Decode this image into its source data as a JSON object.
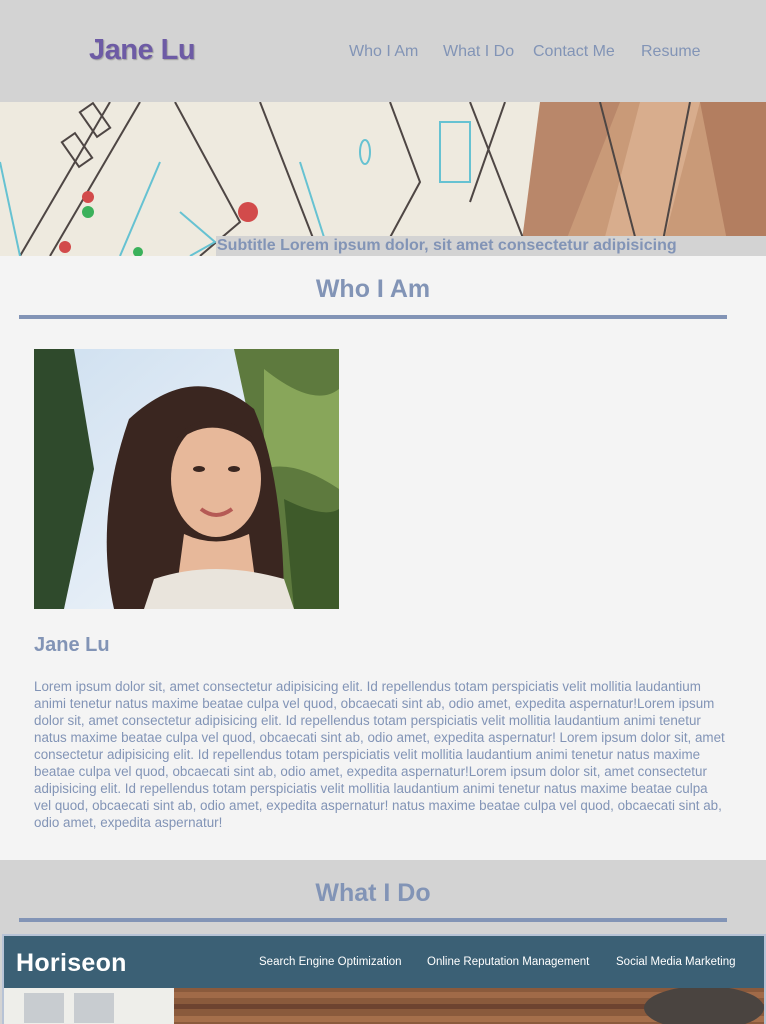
{
  "header": {
    "brand": "Jane Lu",
    "nav": [
      "Who I Am",
      "What I Do",
      "Contact Me",
      "Resume"
    ]
  },
  "hero": {
    "subtitle": "Subtitle Lorem ipsum dolor, sit amet consectetur adipisicing"
  },
  "about": {
    "title": "Who I Am",
    "name": "Jane Lu",
    "bio": "Lorem ipsum dolor sit, amet consectetur adipisicing elit. Id repellendus totam perspiciatis velit mollitia laudantium animi tenetur natus maxime beatae culpa vel quod, obcaecati sint ab, odio amet, expedita aspernatur!Lorem ipsum dolor sit, amet consectetur adipisicing elit. Id repellendus totam perspiciatis velit mollitia laudantium animi tenetur natus maxime beatae culpa vel quod, obcaecati sint ab, odio amet, expedita aspernatur! Lorem ipsum dolor sit, amet consectetur adipisicing elit. Id repellendus totam perspiciatis velit mollitia laudantium animi tenetur natus maxime beatae culpa vel quod, obcaecati sint ab, odio amet, expedita aspernatur!Lorem ipsum dolor sit, amet consectetur adipisicing elit. Id repellendus totam perspiciatis velit mollitia laudantium animi tenetur natus maxime beatae culpa vel quod, obcaecati sint ab, odio amet, expedita aspernatur! natus maxime beatae culpa vel quod, obcaecati sint ab, odio amet, expedita aspernatur!"
  },
  "work": {
    "title": "What I Do",
    "project": {
      "logo": "Horiseon",
      "links": [
        "Search Engine Optimization",
        "Online Reputation Management",
        "Social Media Marketing"
      ]
    }
  },
  "colors": {
    "accent": "#8294b6",
    "brand": "#6d5ba5",
    "header_bg": "#d3d3d3",
    "page_bg": "#f4f4f4",
    "project_bar": "#3b6075"
  }
}
